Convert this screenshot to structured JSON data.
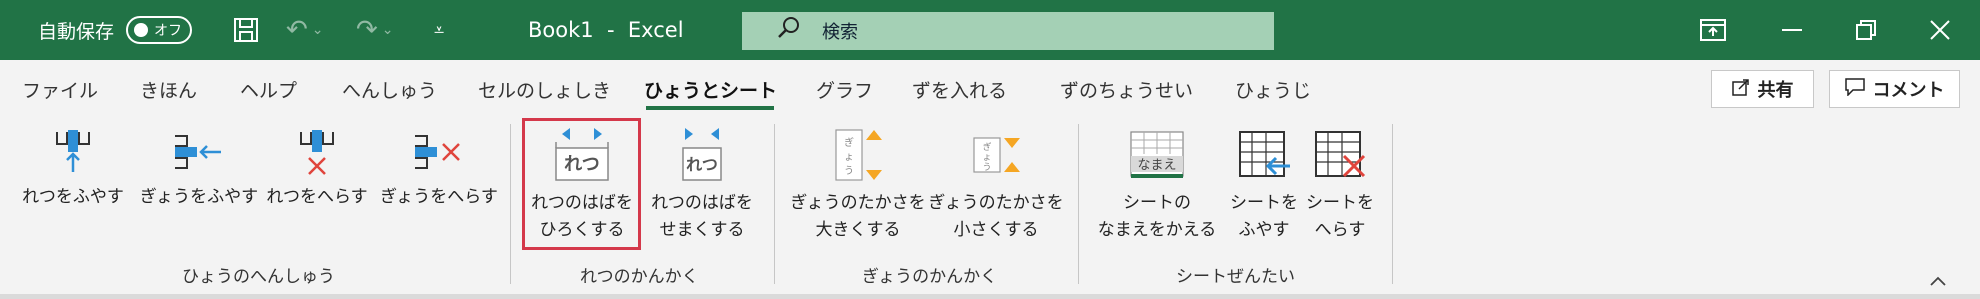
{
  "titlebar": {
    "autosave_label": "自動保存",
    "toggle_state": "オフ",
    "doc_title": "Book1  -  Excel",
    "search_placeholder": "検索"
  },
  "tabs": [
    "ファイル",
    "きほん",
    "ヘルプ",
    "へんしゅう",
    "セルのしょしき",
    "ひょうとシート",
    "グラフ",
    "ずを入れる",
    "ずのちょうせい",
    "ひょうじ"
  ],
  "active_tab": "ひょうとシート",
  "share_label": "共有",
  "comment_label": "コメント",
  "ribbon": {
    "btn_col_add": "れつをふやす",
    "btn_row_add": "ぎょうをふやす",
    "btn_col_remove": "れつをへらす",
    "btn_row_remove": "ぎょうをへらす",
    "btn_col_widen_1": "れつのはばを",
    "btn_col_widen_2": "ひろくする",
    "btn_col_narrow_1": "れつのはばを",
    "btn_col_narrow_2": "せまくする",
    "btn_row_taller_1": "ぎょうのたかさを",
    "btn_row_taller_2": "大きくする",
    "btn_row_shorter_1": "ぎょうのたかさを",
    "btn_row_shorter_2": "小さくする",
    "btn_sheet_rename_1": "シートの",
    "btn_sheet_rename_2": "なまえをかえる",
    "btn_sheet_add_1": "シートを",
    "btn_sheet_add_2": "ふやす",
    "btn_sheet_remove_1": "シートを",
    "btn_sheet_remove_2": "へらす",
    "icon_col_text": "れつ",
    "icon_row_text": "ぎょう",
    "icon_sheet_text": "なまえ",
    "group_edit": "ひょうのへんしゅう",
    "group_col": "れつのかんかく",
    "group_row": "ぎょうのかんかく",
    "group_sheet": "シートぜんたい"
  },
  "colors": {
    "brand": "#217346",
    "highlight": "#d4384a",
    "accent_blue": "#2e8fd6",
    "accent_red": "#e0443c",
    "accent_orange": "#f5a623"
  }
}
